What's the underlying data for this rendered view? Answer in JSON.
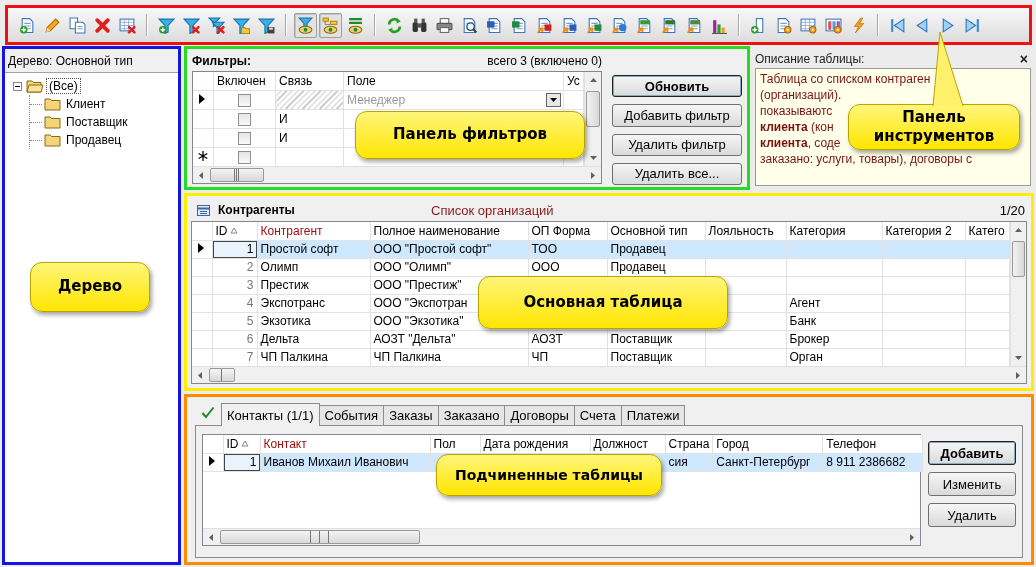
{
  "toolbar": [
    {
      "kind": "newdoc",
      "pressed": false
    },
    {
      "kind": "edit",
      "pressed": false
    },
    {
      "kind": "copy",
      "pressed": false
    },
    {
      "kind": "delete",
      "pressed": false
    },
    {
      "kind": "deltable",
      "pressed": false
    },
    {
      "kind": "sep"
    },
    {
      "kind": "filteradd",
      "pressed": false
    },
    {
      "kind": "filterdel",
      "pressed": false
    },
    {
      "kind": "filterdelall",
      "pressed": false
    },
    {
      "kind": "filteropen",
      "pressed": false
    },
    {
      "kind": "filtersave",
      "pressed": false
    },
    {
      "kind": "sep"
    },
    {
      "kind": "filterview",
      "pressed": true
    },
    {
      "kind": "treeview",
      "pressed": true
    },
    {
      "kind": "sqlview",
      "pressed": false
    },
    {
      "kind": "sep"
    },
    {
      "kind": "refresh",
      "pressed": false
    },
    {
      "kind": "find",
      "pressed": false
    },
    {
      "kind": "print",
      "pressed": false
    },
    {
      "kind": "preview",
      "pressed": false
    },
    {
      "kind": "word",
      "pressed": false
    },
    {
      "kind": "excel",
      "pressed": false
    },
    {
      "kind": "exppdf",
      "pressed": false
    },
    {
      "kind": "expword",
      "pressed": false
    },
    {
      "kind": "expexcel",
      "pressed": false
    },
    {
      "kind": "expweb",
      "pressed": false
    },
    {
      "kind": "expcsv",
      "pressed": false
    },
    {
      "kind": "exptxt",
      "pressed": false
    },
    {
      "kind": "expxml",
      "pressed": false
    },
    {
      "kind": "chart",
      "pressed": false
    },
    {
      "kind": "sep"
    },
    {
      "kind": "addcol",
      "pressed": false
    },
    {
      "kind": "docset",
      "pressed": false
    },
    {
      "kind": "tableset",
      "pressed": false
    },
    {
      "kind": "colset",
      "pressed": false
    },
    {
      "kind": "run",
      "pressed": false
    },
    {
      "kind": "sep"
    },
    {
      "kind": "first",
      "pressed": false
    },
    {
      "kind": "prev",
      "pressed": false
    },
    {
      "kind": "next",
      "pressed": false
    },
    {
      "kind": "last",
      "pressed": false
    }
  ],
  "tree": {
    "title": "Дерево: Основной тип",
    "root": {
      "label": "(Все)",
      "expanded": true,
      "selected": true,
      "children": [
        {
          "label": "Клиент",
          "selected": false
        },
        {
          "label": "Поставщик",
          "selected": false
        },
        {
          "label": "Продавец",
          "selected": false
        }
      ]
    }
  },
  "filters": {
    "title": "Фильтры:",
    "summary": "всего 3 (включено 0)",
    "columns": [
      "Включен",
      "Связь",
      "Поле",
      "Ус"
    ],
    "rows": [
      {
        "kind": "current",
        "enabled": false,
        "disabled": true,
        "field": "Менеджер"
      },
      {
        "kind": "normal",
        "enabled": false,
        "disabled": false,
        "link": "И"
      },
      {
        "kind": "normal",
        "enabled": false,
        "disabled": false,
        "link": "И"
      },
      {
        "kind": "new",
        "enabled": false,
        "disabled": false
      }
    ],
    "buttons": [
      {
        "label": "Обновить",
        "default": true
      },
      {
        "label": "Добавить фильтр",
        "default": false
      },
      {
        "label": "Удалить фильтр",
        "default": false
      },
      {
        "label": "Удалить все...",
        "default": false
      }
    ]
  },
  "description": {
    "title": "Описание таблицы:",
    "close": "×",
    "lines": [
      "Таблица со списком контраген",
      "(организаций).",
      "показываютс",
      "**клиента** (кон",
      "**клиента**, соде",
      "заказано: услуги, товары), договоры с"
    ]
  },
  "main_table": {
    "title": "Контрагенты",
    "caption": "Список организаций",
    "counter": "1/20",
    "columns": [
      {
        "label": "ID",
        "sorted": true,
        "key": false
      },
      {
        "label": "Контрагент",
        "sorted": false,
        "key": true
      },
      {
        "label": "Полное наименование",
        "sorted": false,
        "key": false
      },
      {
        "label": "ОП Форма",
        "sorted": false,
        "key": false
      },
      {
        "label": "Основной тип",
        "sorted": false,
        "key": false
      },
      {
        "label": "Лояльность",
        "sorted": false,
        "key": false
      },
      {
        "label": "Категория",
        "sorted": false,
        "key": false
      },
      {
        "label": "Категория 2",
        "sorted": false,
        "key": false
      },
      {
        "label": "Катего",
        "sorted": false,
        "key": false
      }
    ],
    "rows": [
      {
        "selected": true,
        "cells": [
          "1",
          "Простой софт",
          "ООО \"Простой софт\"",
          "ТОО",
          "Продавец",
          null,
          null,
          null,
          null
        ]
      },
      {
        "selected": false,
        "cells": [
          "2",
          "Олимп",
          "ООО \"Олимп\"",
          "ООО",
          "Продавец",
          null,
          null,
          null,
          null
        ]
      },
      {
        "selected": false,
        "cells": [
          "3",
          "Престиж",
          "ООО \"Престиж\"",
          null,
          null,
          null,
          null,
          null,
          null
        ]
      },
      {
        "selected": false,
        "cells": [
          "4",
          "Экспотранс",
          "ООО \"Экспотран",
          null,
          null,
          null,
          "Агент",
          null,
          null
        ]
      },
      {
        "selected": false,
        "cells": [
          "5",
          "Экзотика",
          "ООО \"Экзотика\"",
          null,
          null,
          null,
          "Банк",
          null,
          null
        ]
      },
      {
        "selected": false,
        "cells": [
          "6",
          "Дельта",
          "АОЗТ \"Дельта\"",
          "АОЗТ",
          "Поставщик",
          null,
          "Брокер",
          null,
          null
        ]
      },
      {
        "selected": false,
        "cells": [
          "7",
          "ЧП Палкина",
          "ЧП Палкина",
          "ЧП",
          "Поставщик",
          null,
          "Орган",
          null,
          null
        ]
      }
    ]
  },
  "sub_tables": {
    "tabs": [
      {
        "label": "Контакты (1/1)",
        "selected": true
      },
      {
        "label": "События",
        "selected": false
      },
      {
        "label": "Заказы",
        "selected": false
      },
      {
        "label": "Заказано",
        "selected": false
      },
      {
        "label": "Договоры",
        "selected": false
      },
      {
        "label": "Счета",
        "selected": false
      },
      {
        "label": "Платежи",
        "selected": false
      }
    ],
    "columns": [
      {
        "label": "ID",
        "sorted": true,
        "key": false
      },
      {
        "label": "Контакт",
        "sorted": false,
        "key": true
      },
      {
        "label": "Пол",
        "sorted": false,
        "key": false
      },
      {
        "label": "Дата рождения",
        "sorted": false,
        "key": false
      },
      {
        "label": "Должност",
        "sorted": false,
        "key": false
      },
      {
        "label": "Страна",
        "sorted": false,
        "key": false
      },
      {
        "label": "Город",
        "sorted": false,
        "key": false
      },
      {
        "label": "Телефон",
        "sorted": false,
        "key": false
      }
    ],
    "rows": [
      {
        "selected": true,
        "cells": [
          "1",
          "Иванов Михаил Иванович",
          null,
          null,
          null,
          "сия",
          "Санкт-Петербург",
          "8 911 2386682"
        ]
      }
    ],
    "buttons": [
      {
        "label": "Добавить",
        "default": true
      },
      {
        "label": "Изменить",
        "default": false
      },
      {
        "label": "Удалить",
        "default": false
      }
    ]
  },
  "callouts": [
    {
      "text": "Дерево",
      "pointer": false
    },
    {
      "text": "Панель фильтров",
      "pointer": false
    },
    {
      "text": "Панель инструментов",
      "pointer": true
    },
    {
      "text": "Основная таблица",
      "pointer": false
    },
    {
      "text": "Подчиненные таблицы",
      "pointer": false
    }
  ]
}
